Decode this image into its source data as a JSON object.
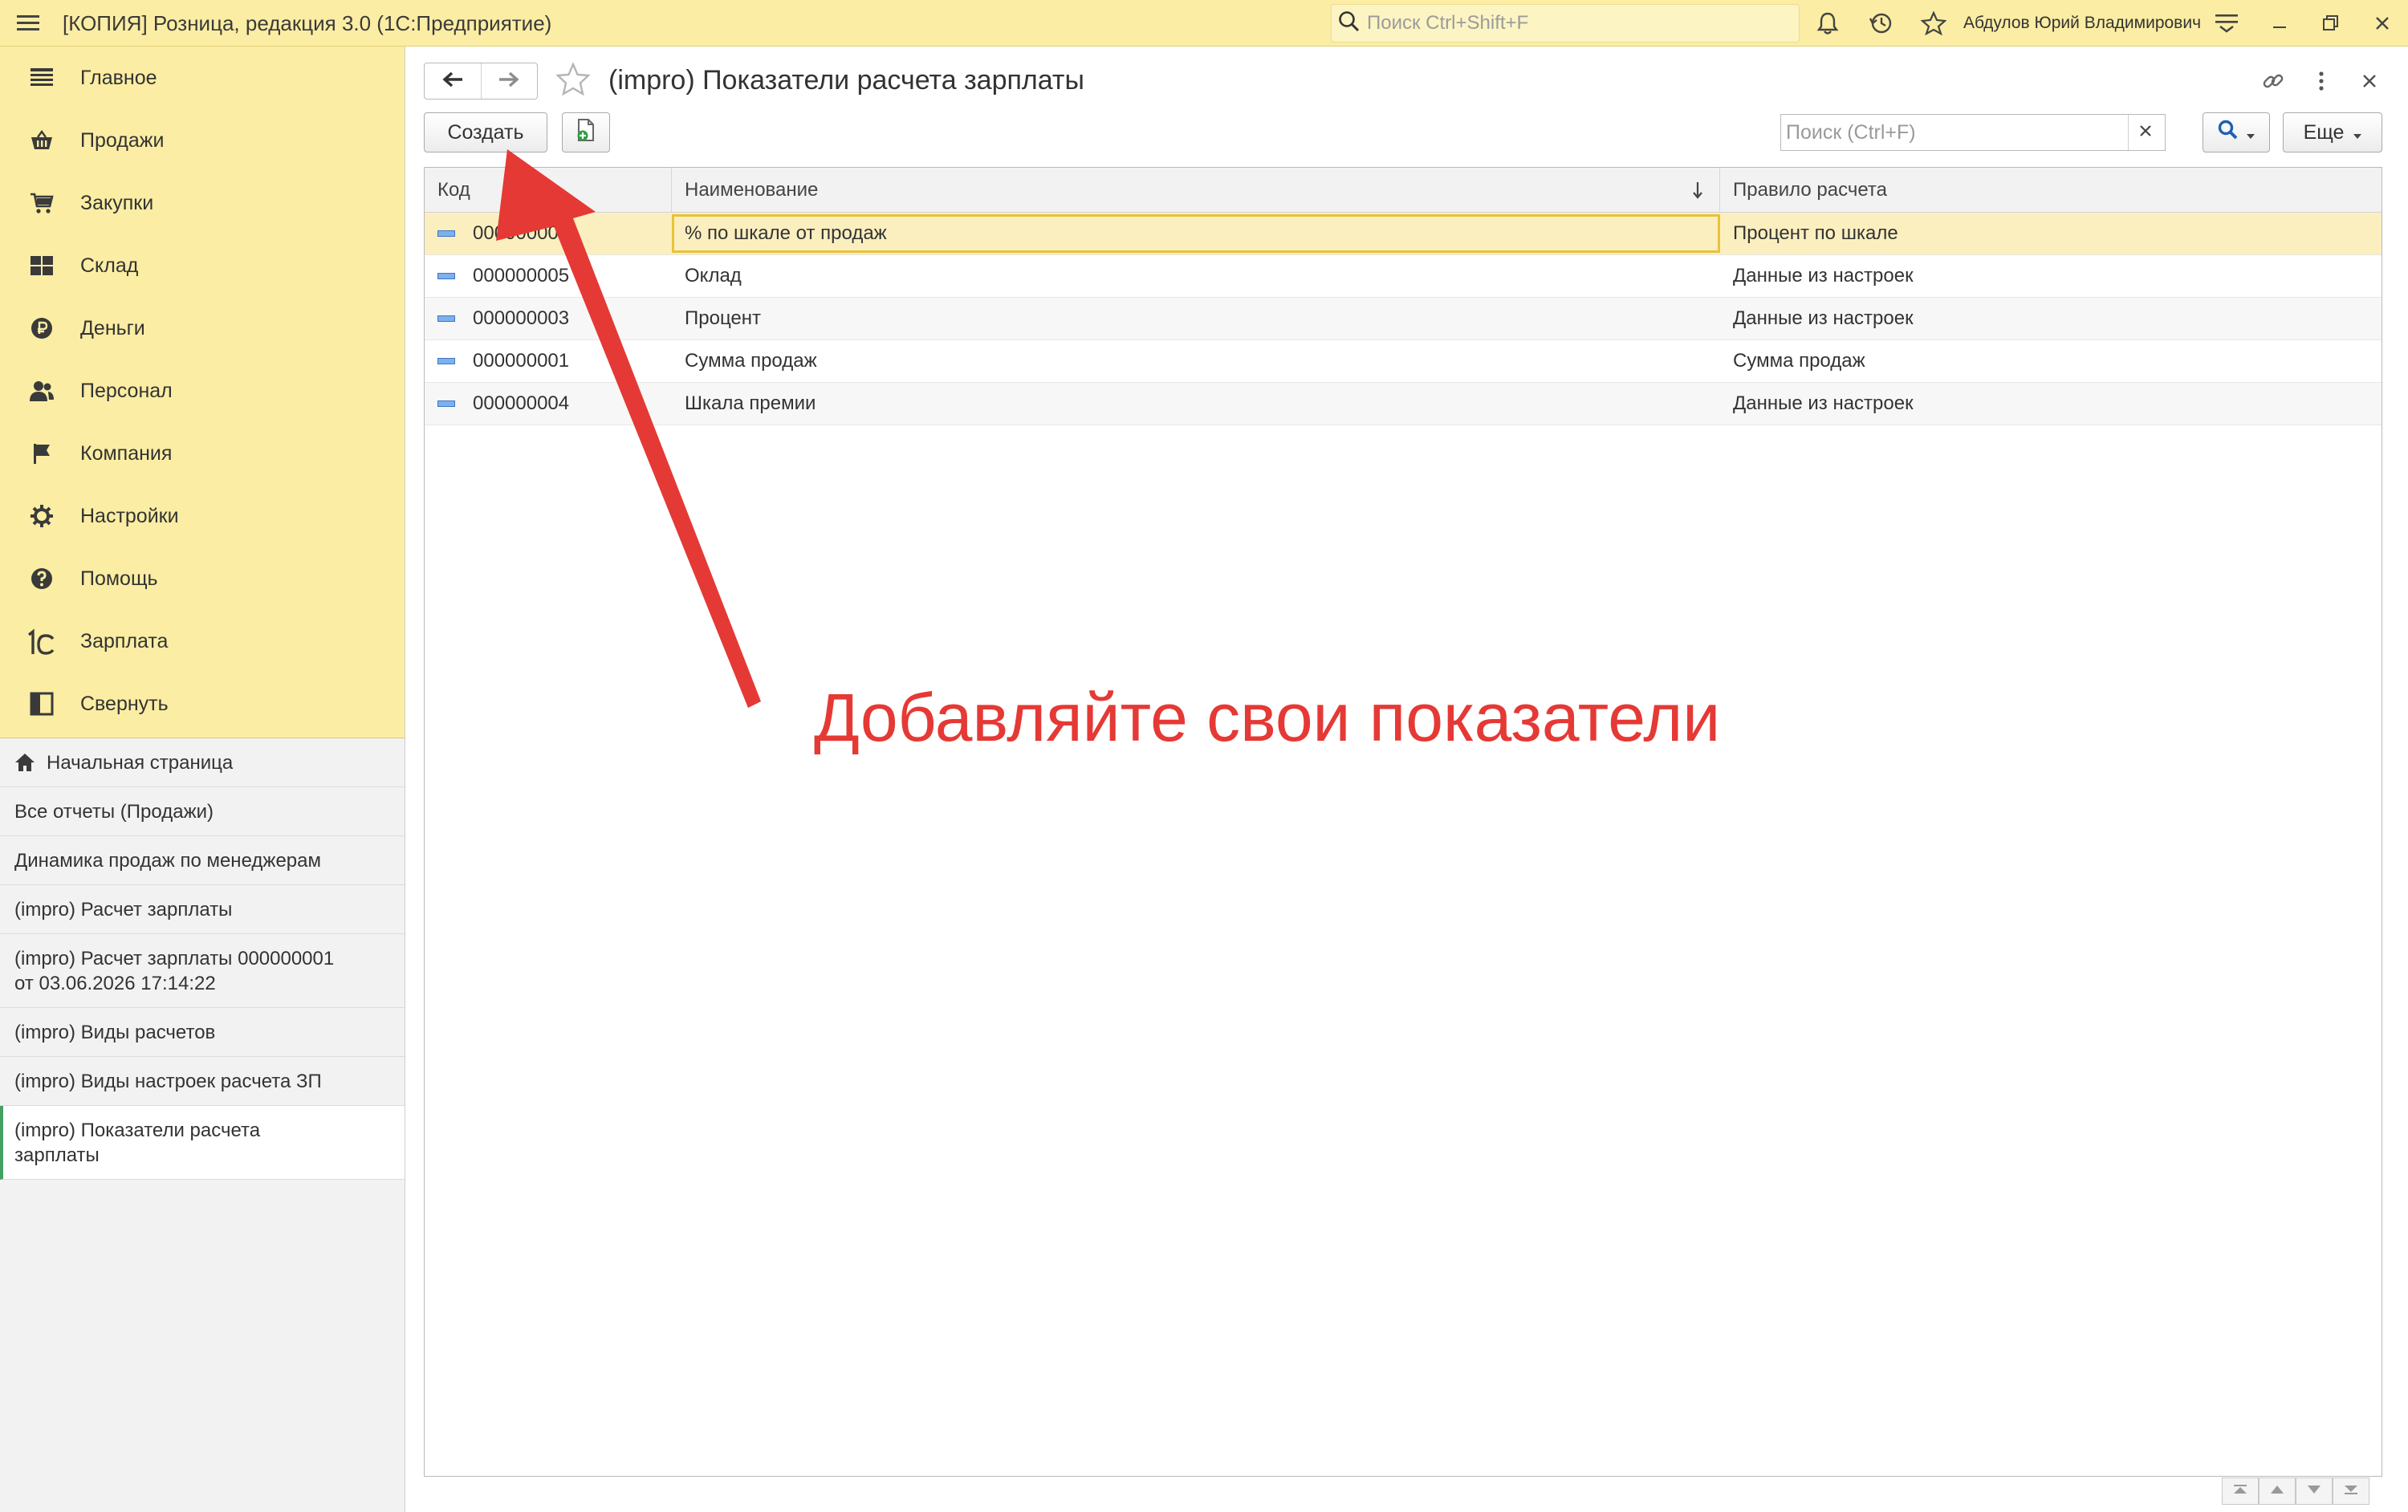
{
  "window": {
    "title": "[КОПИЯ] Розница, редакция 3.0  (1С:Предприятие)",
    "search_placeholder": "Поиск Ctrl+Shift+F",
    "user": "Абдулов Юрий Владимирович"
  },
  "sidebar": {
    "sections": [
      {
        "label": "Главное",
        "icon": "menu-lines-icon"
      },
      {
        "label": "Продажи",
        "icon": "basket-icon"
      },
      {
        "label": "Закупки",
        "icon": "cart-icon"
      },
      {
        "label": "Склад",
        "icon": "warehouse-icon"
      },
      {
        "label": "Деньги",
        "icon": "ruble-icon"
      },
      {
        "label": "Персонал",
        "icon": "people-icon"
      },
      {
        "label": "Компания",
        "icon": "flag-icon"
      },
      {
        "label": "Настройки",
        "icon": "gear-icon"
      },
      {
        "label": "Помощь",
        "icon": "help-icon"
      },
      {
        "label": "Зарплата",
        "icon": "1c-logo-icon"
      },
      {
        "label": "Свернуть",
        "icon": "collapse-icon"
      }
    ],
    "open_windows": [
      {
        "label": "Начальная страница"
      },
      {
        "label": "Все отчеты (Продажи)"
      },
      {
        "label": "Динамика продаж по менеджерам"
      },
      {
        "label": "(impro) Расчет зарплаты"
      },
      {
        "label_line1": "(impro) Расчет зарплаты 000000001",
        "label_line2": "от 03.06.2026 17:14:22"
      },
      {
        "label": "(impro) Виды расчетов"
      },
      {
        "label": "(impro) Виды настроек расчета ЗП"
      },
      {
        "label_line1": "(impro) Показатели расчета",
        "label_line2": "зарплаты"
      }
    ]
  },
  "form": {
    "title": "(impro) Показатели расчета зарплаты",
    "create_label": "Создать",
    "search_placeholder": "Поиск (Ctrl+F)",
    "more_label": "Еще"
  },
  "table": {
    "columns": [
      "Код",
      "Наименование",
      "Правило расчета"
    ],
    "rows": [
      {
        "code": "000000002",
        "name": "% по шкале от продаж",
        "rule": "Процент по шкале"
      },
      {
        "code": "000000005",
        "name": "Оклад",
        "rule": "Данные из настроек"
      },
      {
        "code": "000000003",
        "name": "Процент",
        "rule": "Данные из настроек"
      },
      {
        "code": "000000001",
        "name": "Сумма продаж",
        "rule": "Сумма продаж"
      },
      {
        "code": "000000004",
        "name": "Шкала премии",
        "rule": "Данные из настроек"
      }
    ]
  },
  "annotation": {
    "text": "Добавляйте свои показатели",
    "color": "#e53935"
  },
  "colors": {
    "panel_yellow": "#fbeda3",
    "selected_row": "#fcefbf",
    "active_marker": "#44a163"
  }
}
